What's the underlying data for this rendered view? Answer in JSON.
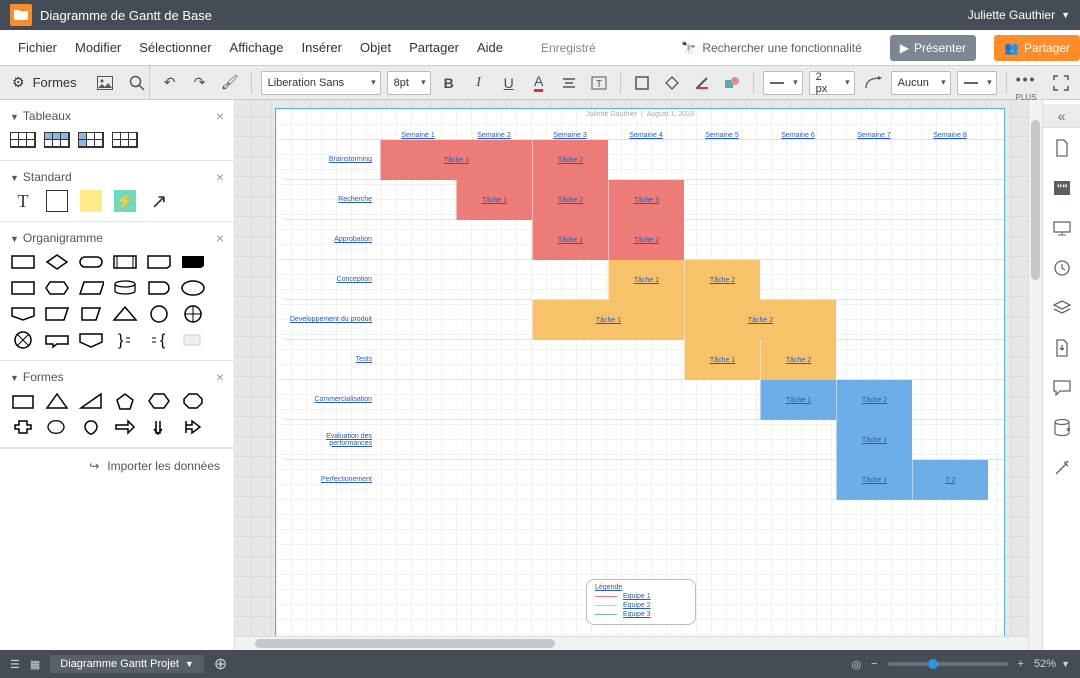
{
  "titlebar": {
    "title": "Diagramme de Gantt de Base",
    "user": "Juliette Gauthier"
  },
  "menubar": {
    "items": [
      "Fichier",
      "Modifier",
      "Sélectionner",
      "Affichage",
      "Insérer",
      "Objet",
      "Partager",
      "Aide"
    ],
    "saved": "Enregistré",
    "search": "Rechercher une fonctionnalité",
    "present": "Présenter",
    "share": "Partager"
  },
  "shapes_header": "Formes",
  "toolbar": {
    "font": "Liberation Sans",
    "size": "8pt",
    "stroke_width": "2 px",
    "end_style": "Aucun",
    "plus_label": "PLUS"
  },
  "panels": {
    "tableaux": "Tableaux",
    "standard": "Standard",
    "organigramme": "Organigramme",
    "formes": "Formes",
    "import": "Importer les données"
  },
  "right_icons": [
    "document-icon",
    "quote-icon",
    "presentation-icon",
    "clock-icon",
    "layers-icon",
    "download-icon",
    "comment-icon",
    "database-icon",
    "magic-icon"
  ],
  "gantt": {
    "subtitle_left": "Juliette Gauthier",
    "subtitle_right": "August 1, 2019",
    "weeks": [
      "Semaine 1",
      "Semaine 2",
      "Semaine 3",
      "Semaine 4",
      "Semaine 5",
      "Semaine 6",
      "Semaine 7",
      "Semaine 8"
    ],
    "rows": [
      {
        "label": "Brainstorming",
        "tasks": [
          {
            "col": 0,
            "span": 2,
            "cls": "red",
            "text": "Tâche 1"
          },
          {
            "col": 2,
            "span": 1,
            "cls": "red",
            "text": "Tâche 2"
          }
        ]
      },
      {
        "label": "Recherche",
        "tasks": [
          {
            "col": 1,
            "span": 1,
            "cls": "red",
            "text": "Tâche 1"
          },
          {
            "col": 2,
            "span": 1,
            "cls": "red",
            "text": "Tâche 2"
          },
          {
            "col": 3,
            "span": 1,
            "cls": "red",
            "text": "Tâche 3"
          }
        ]
      },
      {
        "label": "Approbation",
        "tasks": [
          {
            "col": 2,
            "span": 1,
            "cls": "red",
            "text": "Tâche 1"
          },
          {
            "col": 3,
            "span": 1,
            "cls": "red",
            "text": "Tâche 2"
          }
        ]
      },
      {
        "label": "Conception",
        "tasks": [
          {
            "col": 3,
            "span": 1,
            "cls": "yellow",
            "text": "Tâche 1"
          },
          {
            "col": 4,
            "span": 1,
            "cls": "yellow",
            "text": "Tâche 2"
          }
        ]
      },
      {
        "label": "Developpement du produit",
        "tasks": [
          {
            "col": 2,
            "span": 2,
            "cls": "yellow",
            "text": "Tâche 1"
          },
          {
            "col": 4,
            "span": 2,
            "cls": "yellow",
            "text": "Tâche 2"
          }
        ]
      },
      {
        "label": "Tests",
        "tasks": [
          {
            "col": 4,
            "span": 1,
            "cls": "yellow",
            "text": "Tâche 1"
          },
          {
            "col": 5,
            "span": 1,
            "cls": "yellow",
            "text": "Tâche 2"
          }
        ]
      },
      {
        "label": "Commercialisation",
        "tasks": [
          {
            "col": 5,
            "span": 1,
            "cls": "blue",
            "text": "Tâche 1"
          },
          {
            "col": 6,
            "span": 1,
            "cls": "blue",
            "text": "Tâche 2"
          }
        ]
      },
      {
        "label": "Evaluation des performances",
        "tasks": [
          {
            "col": 6,
            "span": 1,
            "cls": "blue",
            "text": "Tâche 1"
          }
        ]
      },
      {
        "label": "Perfectionement",
        "tasks": [
          {
            "col": 6,
            "span": 1,
            "cls": "blue",
            "text": "Tâche 1"
          },
          {
            "col": 7,
            "span": 1,
            "cls": "blue",
            "text": "T 2"
          }
        ]
      }
    ],
    "legend_title": "Légende",
    "legend": [
      {
        "label": "Equipe 1",
        "color": "#ed7b77"
      },
      {
        "label": "Equipe 2",
        "color": "#f6c36a"
      },
      {
        "label": "Equipe 3",
        "color": "#6daee8"
      }
    ]
  },
  "bottombar": {
    "tab": "Diagramme Gantt Projet",
    "zoom": "52%"
  }
}
